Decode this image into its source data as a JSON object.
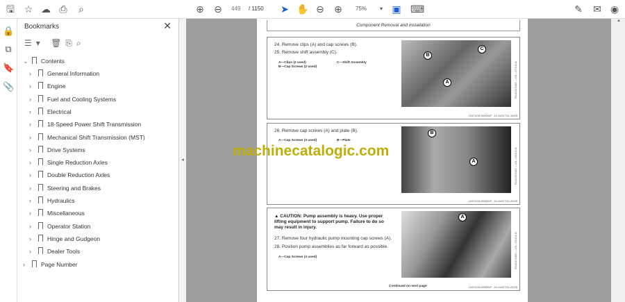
{
  "toolbar": {
    "page_current": "449",
    "page_total": "/ 1150",
    "zoom": "75%"
  },
  "bookmarks": {
    "title": "Bookmarks",
    "root": "Contents",
    "items": [
      "General Information",
      "Engine",
      "Fuel and Cooling Systems",
      "Electrical",
      "18-Speed Power Shift Transmission",
      "Mechanical Shift Transmission (MST)",
      "Drive Systems",
      "Single Reduction Axles",
      "Double Reduction Axles",
      "Steering and Brakes",
      "Hydraulics",
      "Miscellaneous",
      "Operator Station",
      "Hinge and Gudgeon",
      "Dealer Tools"
    ],
    "last": "Page Number"
  },
  "page": {
    "header": "Component Removal and Installation",
    "s1": {
      "step1": "24. Remove clips (A) and cap screws (B).",
      "step2": "25. Remove shift assembly (C).",
      "legA": "A—Clips (2 used)",
      "legB": "B—Cap Screws (2 used)",
      "legC": "C—Shift Assembly",
      "ref": "LM71216,000022F -19-11OCT11-19/25",
      "side": "RXA0119435 —UN—27JUL11"
    },
    "s2": {
      "step1": "26. Remove cap screws (A) and plate (B).",
      "legA": "A—Cap Screws (3 used)",
      "legB": "B—Plate",
      "ref": "LM71216,000022F -19-11OCT11-20/25",
      "side": "RXA0119440 —UN—03JUL11"
    },
    "s3": {
      "caution": "CAUTION: Pump assembly is heavy. Use proper lifting equipment to support pump. Failure to do so may result in injury.",
      "step1": "27. Remove four hydraulic pump mounting cap screws (A).",
      "step2": "28. Position pump assemblies as far forward as possible.",
      "legA": "A—Cap Screws (4 used)",
      "cont": "Continued on next page",
      "ref": "LM71216,000022F -19-11OCT11-21/25",
      "side": "RXA0119450 —UN—03JUL11"
    }
  },
  "watermark": "machinecatalogic.com"
}
